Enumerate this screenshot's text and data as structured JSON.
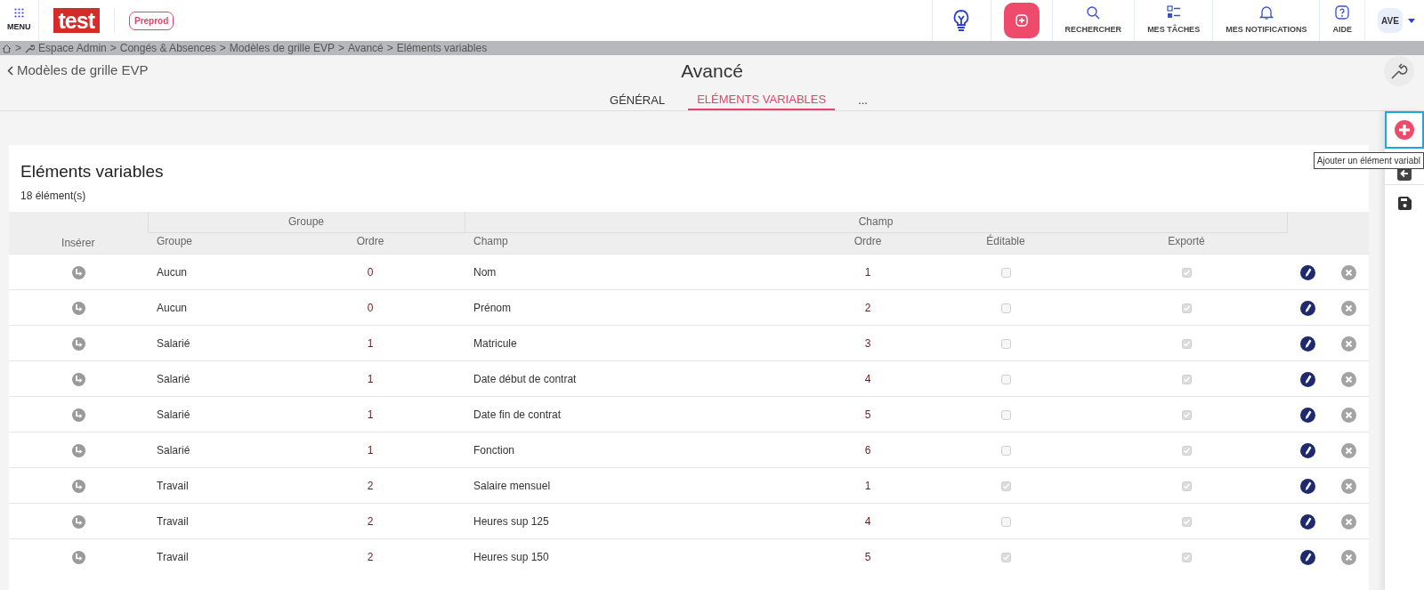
{
  "header": {
    "menu_label": "MENU",
    "logo": "test",
    "env_badge": "Preprod",
    "nav": [
      {
        "kind": "search",
        "label": "RECHERCHER"
      },
      {
        "kind": "tasks",
        "label": "MES TÂCHES"
      },
      {
        "kind": "bell",
        "label": "MES NOTIFICATIONS"
      },
      {
        "kind": "help",
        "label": "AIDE"
      }
    ],
    "avatar": "AVE"
  },
  "breadcrumb": [
    {
      "kind": "home"
    },
    {
      "kind": "sep",
      "text": ">"
    },
    {
      "kind": "tool"
    },
    {
      "kind": "crumb",
      "text": "Espace Admin"
    },
    {
      "kind": "sep",
      "text": ">"
    },
    {
      "kind": "crumb",
      "text": "Congés & Absences"
    },
    {
      "kind": "sep",
      "text": ">"
    },
    {
      "kind": "crumb",
      "text": "Modèles de grille EVP"
    },
    {
      "kind": "sep",
      "text": ">"
    },
    {
      "kind": "crumb",
      "text": "Avancé"
    },
    {
      "kind": "sep",
      "text": ">"
    },
    {
      "kind": "crumb",
      "text": "Eléments variables"
    }
  ],
  "back_link": "Modèles de grille EVP",
  "page_title": "Avancé",
  "tabs": [
    {
      "label": "GÉNÉRAL",
      "selected": false
    },
    {
      "label": "ELÉMENTS VARIABLES",
      "selected": true
    },
    {
      "label": "...",
      "selected": false
    }
  ],
  "card": {
    "title": "Eléments variables",
    "count": "18 élément(s)"
  },
  "table": {
    "group_headers": [
      "Groupe",
      "Champ"
    ],
    "columns": [
      "Insérer",
      "Groupe",
      "Ordre",
      "Champ",
      "Ordre",
      "Éditable",
      "Exporté"
    ],
    "rows": [
      {
        "group": "Aucun",
        "group_order": "0",
        "field": "Nom",
        "field_order": "1",
        "editable": false,
        "exported": true
      },
      {
        "group": "Aucun",
        "group_order": "0",
        "field": "Prénom",
        "field_order": "2",
        "editable": false,
        "exported": true
      },
      {
        "group": "Salarié",
        "group_order": "1",
        "field": "Matricule",
        "field_order": "3",
        "editable": false,
        "exported": true
      },
      {
        "group": "Salarié",
        "group_order": "1",
        "field": "Date début de contrat",
        "field_order": "4",
        "editable": false,
        "exported": true
      },
      {
        "group": "Salarié",
        "group_order": "1",
        "field": "Date fin de contrat",
        "field_order": "5",
        "editable": false,
        "exported": true
      },
      {
        "group": "Salarié",
        "group_order": "1",
        "field": "Fonction",
        "field_order": "6",
        "editable": false,
        "exported": true
      },
      {
        "group": "Travail",
        "group_order": "2",
        "field": "Salaire mensuel",
        "field_order": "1",
        "editable": true,
        "exported": true
      },
      {
        "group": "Travail",
        "group_order": "2",
        "field": "Heures sup 125",
        "field_order": "4",
        "editable": false,
        "exported": true
      },
      {
        "group": "Travail",
        "group_order": "2",
        "field": "Heures sup 150",
        "field_order": "5",
        "editable": true,
        "exported": true
      }
    ]
  },
  "side_tooltip": "Ajouter un élément variabl"
}
